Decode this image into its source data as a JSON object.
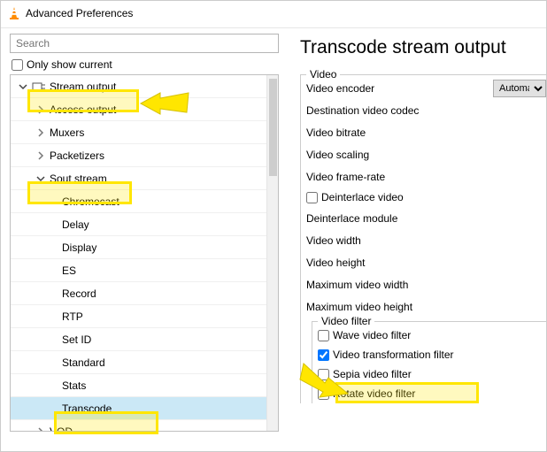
{
  "title": "Advanced Preferences",
  "search": {
    "placeholder": "Search"
  },
  "only_show_current_label": "Only show current",
  "tree": {
    "stream_output": "Stream output",
    "access_output": "Access output",
    "muxers": "Muxers",
    "packetizers": "Packetizers",
    "sout_stream": "Sout stream",
    "chromecast": "Chromecast",
    "delay": "Delay",
    "display": "Display",
    "es": "ES",
    "record": "Record",
    "rtp": "RTP",
    "set_id": "Set ID",
    "standard": "Standard",
    "stats": "Stats",
    "transcode": "Transcode",
    "vod": "VOD"
  },
  "section_title": "Transcode stream output",
  "video_group_label": "Video",
  "form": {
    "video_encoder": "Video encoder",
    "video_encoder_value": "Automatic",
    "dest_codec": "Destination video codec",
    "bitrate": "Video bitrate",
    "scaling": "Video scaling",
    "framerate": "Video frame-rate",
    "deinterlace": "Deinterlace video",
    "deint_module": "Deinterlace module",
    "width": "Video width",
    "height": "Video height",
    "max_width": "Maximum video width",
    "max_height": "Maximum video height"
  },
  "filter_group_label": "Video filter",
  "filters": {
    "wave": "Wave video filter",
    "transform": "Video transformation filter",
    "sepia": "Sepia video filter",
    "rotate": "Rotate video filter"
  }
}
